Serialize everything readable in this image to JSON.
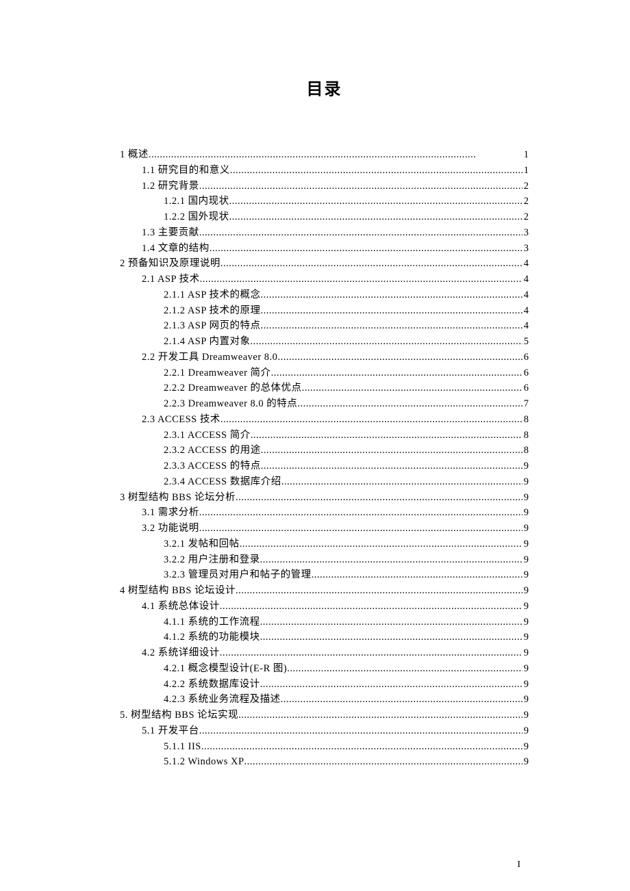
{
  "title": "目录",
  "page_number": "I",
  "entries": [
    {
      "level": 0,
      "label": "1 概述 ",
      "page": "1"
    },
    {
      "level": 1,
      "label": "1.1 研究目的和意义 ",
      "page": "1"
    },
    {
      "level": 1,
      "label": "1.2 研究背景 ",
      "page": "2"
    },
    {
      "level": 2,
      "label": "1.2.1 国内现状 ",
      "page": "2"
    },
    {
      "level": 2,
      "label": "1.2.2 国外现状 ",
      "page": "2"
    },
    {
      "level": 1,
      "label": "1.3 主要贡献 ",
      "page": "3"
    },
    {
      "level": 1,
      "label": "1.4 文章的结构 ",
      "page": "3"
    },
    {
      "level": 0,
      "label": "2 预备知识及原理说明 ",
      "page": "4"
    },
    {
      "level": 1,
      "label": "2.1 ASP 技术 ",
      "page": "4"
    },
    {
      "level": 2,
      "label": "2.1.1 ASP 技术的概念 ",
      "page": "4"
    },
    {
      "level": 2,
      "label": "2.1.2 ASP 技术的原理 ",
      "page": "4"
    },
    {
      "level": 2,
      "label": "2.1.3 ASP 网页的特点 ",
      "page": "4"
    },
    {
      "level": 2,
      "label": "2.1.4 ASP 内置对象 ",
      "page": "5"
    },
    {
      "level": 1,
      "label": "2.2 开发工具 Dreamweaver 8.0",
      "page": "6"
    },
    {
      "level": 2,
      "label": "2.2.1 Dreamweaver 简介",
      "page": "6"
    },
    {
      "level": 2,
      "label": "2.2.2 Dreamweaver 的总体优点",
      "page": "6"
    },
    {
      "level": 2,
      "label": "2.2.3 Dreamweaver 8.0 的特点 ",
      "page": "7"
    },
    {
      "level": 1,
      "label": "2.3 ACCESS 技术 ",
      "page": "8"
    },
    {
      "level": 2,
      "label": "2.3.1 ACCESS 简介 ",
      "page": "8"
    },
    {
      "level": 2,
      "label": "2.3.2 ACCESS 的用途 ",
      "page": "8"
    },
    {
      "level": 2,
      "label": "2.3.3 ACCESS 的特点 ",
      "page": "9"
    },
    {
      "level": 2,
      "label": "2.3.4 ACCESS 数据库介绍 ",
      "page": "9"
    },
    {
      "level": 0,
      "label": "3 树型结构 BBS 论坛分析",
      "page": "9"
    },
    {
      "level": 1,
      "label": "3.1 需求分析 ",
      "page": "9"
    },
    {
      "level": 1,
      "label": "3.2 功能说明 ",
      "page": "9"
    },
    {
      "level": 2,
      "label": "3.2.1 发帖和回帖",
      "page": "9"
    },
    {
      "level": 2,
      "label": "3.2.2 用户注册和登录",
      "page": "9"
    },
    {
      "level": 2,
      "label": "3.2.3 管理员对用户和帖子的管理",
      "page": "9"
    },
    {
      "level": 0,
      "label": "4 树型结构 BBS 论坛设计",
      "page": "9"
    },
    {
      "level": 1,
      "label": "4.1 系统总体设计 ",
      "page": "9"
    },
    {
      "level": 2,
      "label": "4.1.1 系统的工作流程 ",
      "page": "9"
    },
    {
      "level": 2,
      "label": "4.1.2 系统的功能模块 ",
      "page": "9"
    },
    {
      "level": 1,
      "label": "4.2 系统详细设计 ",
      "page": "9"
    },
    {
      "level": 2,
      "label": "4.2.1 概念模型设计(E-R 图)",
      "page": "9"
    },
    {
      "level": 2,
      "label": "4.2.2 系统数据库设计 ",
      "page": "9"
    },
    {
      "level": 2,
      "label": "4.2.3 系统业务流程及描述 ",
      "page": "9"
    },
    {
      "level": 0,
      "label": "5. 树型结构 BBS 论坛实现",
      "page": "9"
    },
    {
      "level": 1,
      "label": "5.1 开发平台 ",
      "page": "9"
    },
    {
      "level": 2,
      "label": "5.1.1 IIS",
      "page": "9"
    },
    {
      "level": 2,
      "label": "5.1.2 Windows XP",
      "page": "9"
    }
  ]
}
